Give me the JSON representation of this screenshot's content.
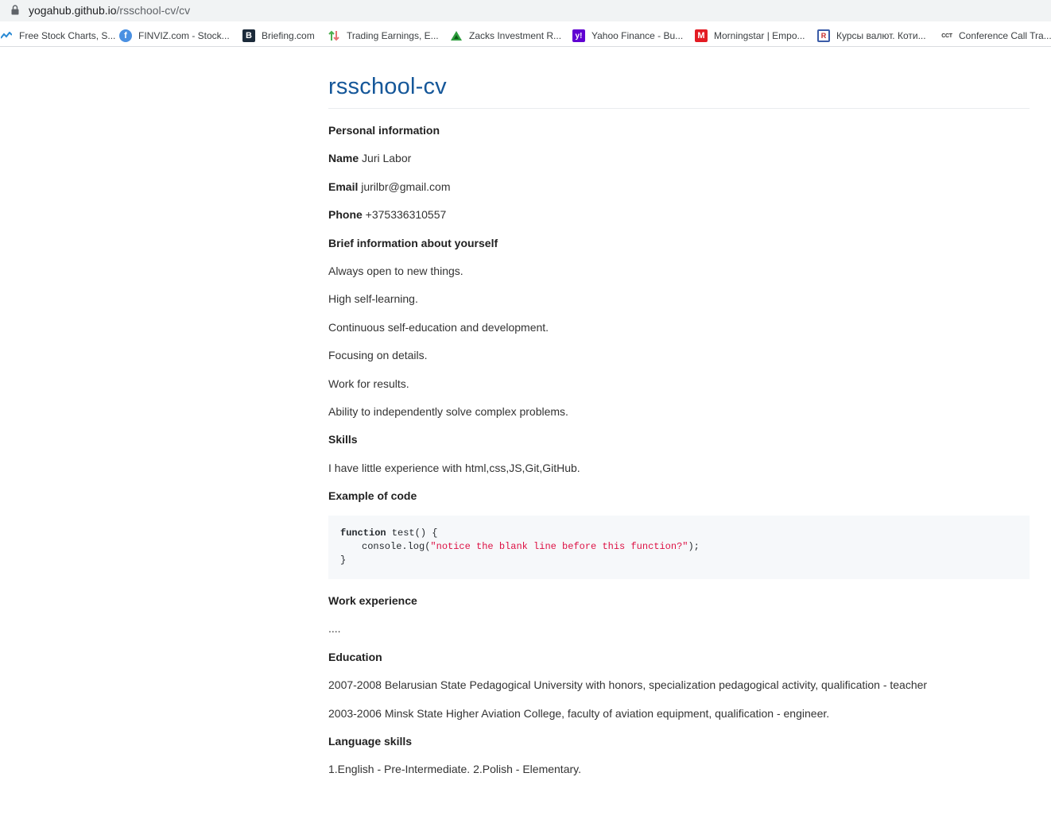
{
  "browser": {
    "url_host": "yogahub.github.io",
    "url_path": "/rsschool-cv/cv",
    "bookmarks": [
      {
        "label": "Free Stock Charts, S...",
        "icon": "stockcharts-icon"
      },
      {
        "label": "FINVIZ.com - Stock...",
        "icon": "facebook-icon"
      },
      {
        "label": "Briefing.com",
        "icon": "briefing-icon"
      },
      {
        "label": "Trading Earnings, E...",
        "icon": "arrows-icon"
      },
      {
        "label": "Zacks Investment R...",
        "icon": "zacks-icon"
      },
      {
        "label": "Yahoo Finance - Bu...",
        "icon": "yahoo-icon"
      },
      {
        "label": "Morningstar | Empo...",
        "icon": "morningstar-icon"
      },
      {
        "label": "Курсы валют. Коти...",
        "icon": "currency-icon"
      },
      {
        "label": "Conference Call Tra...",
        "icon": "cct-icon"
      }
    ]
  },
  "page": {
    "title": "rsschool-cv",
    "personal_heading": "Personal information",
    "name_label": "Name",
    "name_value": " Juri Labor",
    "email_label": "Email",
    "email_value": " jurilbr@gmail.com",
    "phone_label": "Phone",
    "phone_value": " +375336310557",
    "brief_heading": "Brief information about yourself",
    "brief_items": [
      "Always open to new things.",
      "High self-learning.",
      "Continuous self-education and development.",
      "Focusing on details.",
      "Work for results.",
      "Ability to independently solve complex problems."
    ],
    "skills_heading": "Skills",
    "skills_text": "I have little experience with html,css,JS,Git,GitHub.",
    "code_heading": "Example of code",
    "code": {
      "kw": "function",
      "line1_rest": " test() {",
      "line2_pre": "console.log(",
      "line2_str": "\"notice the blank line before this function?\"",
      "line2_post": ");",
      "line3": "}"
    },
    "work_heading": "Work experience",
    "work_text": "....",
    "education_heading": "Education",
    "education_items": [
      "2007-2008 Belarusian State Pedagogical University with honors, specialization pedagogical activity, qualification - teacher",
      "2003-2006 Minsk State Higher Aviation College, faculty of aviation equipment, qualification - engineer."
    ],
    "language_heading": "Language skills",
    "language_text": "1.English - Pre-Intermediate. 2.Polish - Elementary."
  }
}
